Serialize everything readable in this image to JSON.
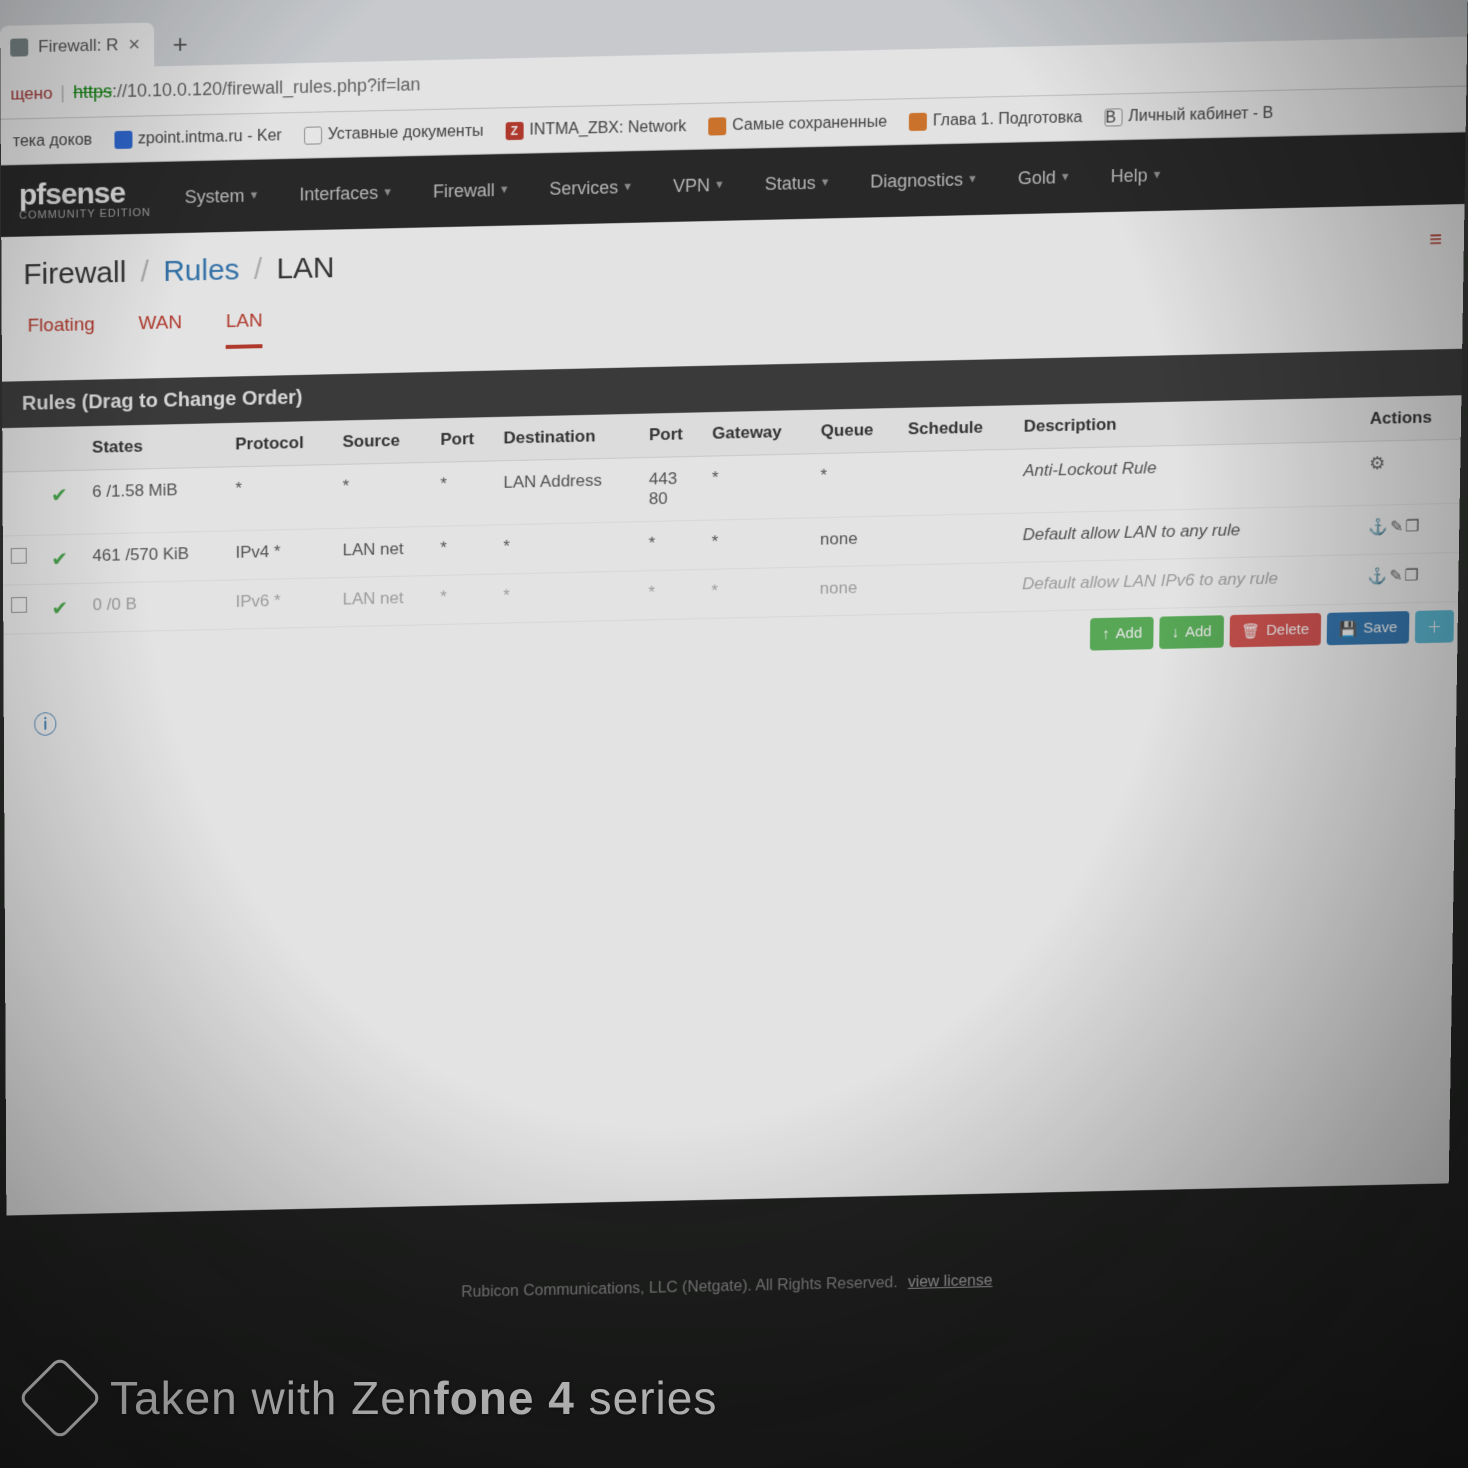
{
  "browser": {
    "tab_title": "Firewall: R",
    "url_secure_label": "щено",
    "url_protocol": "https",
    "url_host_path": "://10.10.0.120/firewall_rules.php?if=lan",
    "bookmarks": [
      {
        "label": "тека доков"
      },
      {
        "label": "zpoint.intma.ru - Ker",
        "icon": "blue"
      },
      {
        "label": "Уставные документы",
        "icon": "doc"
      },
      {
        "label": "INTMA_ZBX: Network",
        "icon": "red",
        "icon_text": "Z"
      },
      {
        "label": "Самые сохраненные",
        "icon": "orange"
      },
      {
        "label": "Глава 1. Подготовка",
        "icon": "orange"
      },
      {
        "label": "Личный кабинет - В",
        "icon": "bk",
        "icon_text": "B"
      }
    ]
  },
  "nav": {
    "logo_main": "sense",
    "logo_prefix": "pf",
    "logo_sub": "COMMUNITY EDITION",
    "items": [
      "System",
      "Interfaces",
      "Firewall",
      "Services",
      "VPN",
      "Status",
      "Diagnostics",
      "Gold",
      "Help"
    ]
  },
  "breadcrumb": {
    "a": "Firewall",
    "b": "Rules",
    "c": "LAN"
  },
  "tabs": [
    "Floating",
    "WAN",
    "LAN"
  ],
  "active_tab": "LAN",
  "panel_title": "Rules (Drag to Change Order)",
  "columns": [
    "",
    "",
    "States",
    "Protocol",
    "Source",
    "Port",
    "Destination",
    "Port",
    "Gateway",
    "Queue",
    "Schedule",
    "Description",
    "Actions"
  ],
  "rows": [
    {
      "checkbox": false,
      "pass": true,
      "states": "6 /1.58 MiB",
      "protocol": "*",
      "source": "*",
      "sport": "*",
      "dest": "LAN Address",
      "dport": "443\n80",
      "gateway": "*",
      "queue": "*",
      "schedule": "",
      "desc": "Anti-Lockout Rule",
      "actions": "gear",
      "dim": false
    },
    {
      "checkbox": true,
      "pass": true,
      "states": "461 /570 KiB",
      "protocol": "IPv4 *",
      "source": "LAN net",
      "sport": "*",
      "dest": "*",
      "dport": "*",
      "gateway": "*",
      "queue": "none",
      "schedule": "",
      "desc": "Default allow LAN to any rule",
      "actions": "row",
      "dim": false
    },
    {
      "checkbox": true,
      "pass": true,
      "states": "0 /0 B",
      "protocol": "IPv6 *",
      "source": "LAN net",
      "sport": "*",
      "dest": "*",
      "dport": "*",
      "gateway": "*",
      "queue": "none",
      "schedule": "",
      "desc": "Default allow LAN IPv6 to any rule",
      "actions": "row",
      "dim": true
    }
  ],
  "buttons": {
    "add1": "Add",
    "add2": "Add",
    "delete": "Delete",
    "save": "Save"
  },
  "footer": {
    "text": "Rubicon Communications, LLC (Netgate). All Rights Reserved.",
    "link": "view license"
  },
  "watermark": {
    "pre": "Taken with Zen",
    "bold": "fone 4",
    "post": " series"
  }
}
